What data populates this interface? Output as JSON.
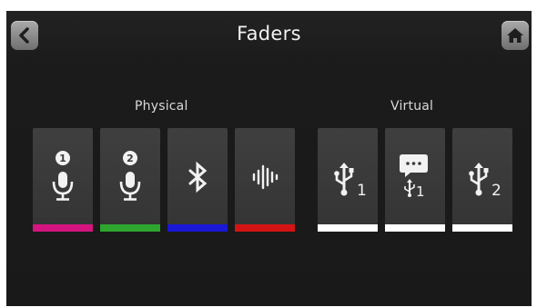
{
  "header": {
    "title": "Faders"
  },
  "sections": {
    "physical": "Physical",
    "virtual": "Virtual"
  },
  "physical": [
    {
      "icon": "mic-1-icon",
      "number": "1",
      "color": "#d4157f"
    },
    {
      "icon": "mic-2-icon",
      "number": "2",
      "color": "#2ea52e"
    },
    {
      "icon": "bluetooth-icon",
      "color": "#1a17d6"
    },
    {
      "icon": "sound-wave-icon",
      "color": "#d41414"
    }
  ],
  "virtual": [
    {
      "icon": "usb-icon",
      "sub": "1",
      "color": "#ffffff"
    },
    {
      "icon": "usb-chat-icon",
      "sub": "1",
      "color": "#ffffff"
    },
    {
      "icon": "usb-icon",
      "sub": "2",
      "color": "#ffffff"
    }
  ]
}
